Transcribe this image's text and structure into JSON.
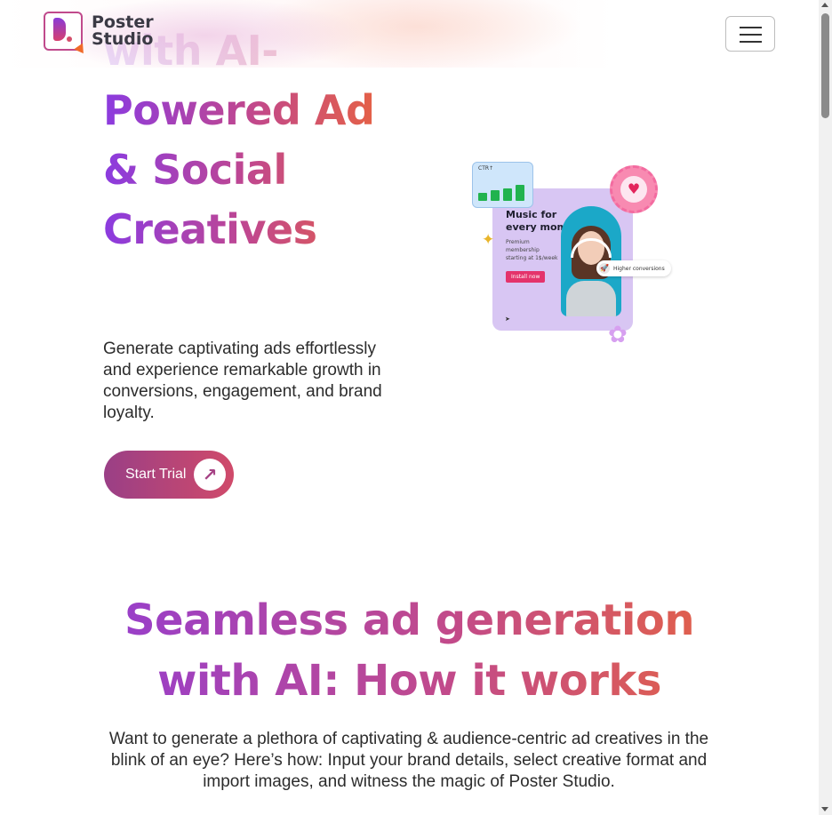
{
  "header": {
    "logo_line1": "Poster",
    "logo_line2": "Studio"
  },
  "hero": {
    "title_lines": [
      "with AI-",
      "Powered Ad",
      "& Social",
      "Creatives"
    ],
    "description": "Generate captivating ads effortlessly and experience remarkable growth in conversions, engagement, and brand loyalty.",
    "cta_label": "Start Trial"
  },
  "illustration": {
    "ctr_label": "CTR↑",
    "ctr_bars": [
      0.35,
      0.45,
      0.55,
      0.7
    ],
    "music_title_line1": "Music for",
    "music_title_line2": "every moment",
    "music_sub": "Premium membership starting at 1$/week",
    "install_label": "Install now",
    "conversions_label": "Higher conversions"
  },
  "section": {
    "title_line1": "Seamless ad generation",
    "title_line2": "with AI: How it works",
    "description": "Want to generate a plethora of captivating & audience-centric ad creatives in the blink of an eye? Here’s how: Input your brand details, select creative format and import images, and witness the magic of Poster Studio."
  },
  "colors": {
    "gradient_start": "#8b3be0",
    "gradient_mid": "#c0478f",
    "gradient_end": "#f26a2c",
    "cta_start": "#9a3f86",
    "cta_end": "#d04a6a"
  }
}
